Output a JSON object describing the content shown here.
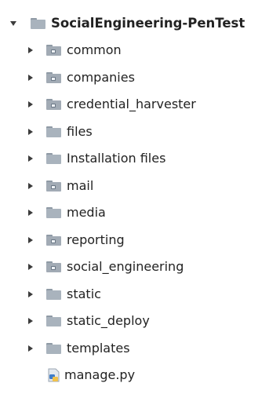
{
  "colors": {
    "folder": "#a9b3bd",
    "folder_tab": "#8f9aa5",
    "package_folder": "#a2abb5",
    "text": "#222222",
    "python_blue": "#3f7cc8",
    "python_yellow": "#f2c24a"
  },
  "tree": {
    "root": {
      "label": "SocialEngineering-PenTest",
      "expanded": true,
      "icon": "folder-icon"
    },
    "children": [
      {
        "label": "common",
        "type": "package",
        "expanded": false,
        "icon": "package-folder-icon"
      },
      {
        "label": "companies",
        "type": "package",
        "expanded": false,
        "icon": "package-folder-icon"
      },
      {
        "label": "credential_harvester",
        "type": "package",
        "expanded": false,
        "icon": "package-folder-icon"
      },
      {
        "label": "files",
        "type": "folder",
        "expanded": false,
        "icon": "folder-icon"
      },
      {
        "label": "Installation files",
        "type": "folder",
        "expanded": false,
        "icon": "folder-icon"
      },
      {
        "label": "mail",
        "type": "package",
        "expanded": false,
        "icon": "package-folder-icon"
      },
      {
        "label": "media",
        "type": "folder",
        "expanded": false,
        "icon": "folder-icon"
      },
      {
        "label": "reporting",
        "type": "package",
        "expanded": false,
        "icon": "package-folder-icon"
      },
      {
        "label": "social_engineering",
        "type": "package",
        "expanded": false,
        "icon": "package-folder-icon"
      },
      {
        "label": "static",
        "type": "folder",
        "expanded": false,
        "icon": "folder-icon"
      },
      {
        "label": "static_deploy",
        "type": "folder",
        "expanded": false,
        "icon": "folder-icon"
      },
      {
        "label": "templates",
        "type": "folder",
        "expanded": false,
        "icon": "folder-icon"
      },
      {
        "label": "manage.py",
        "type": "file",
        "icon": "python-file-icon"
      }
    ]
  }
}
